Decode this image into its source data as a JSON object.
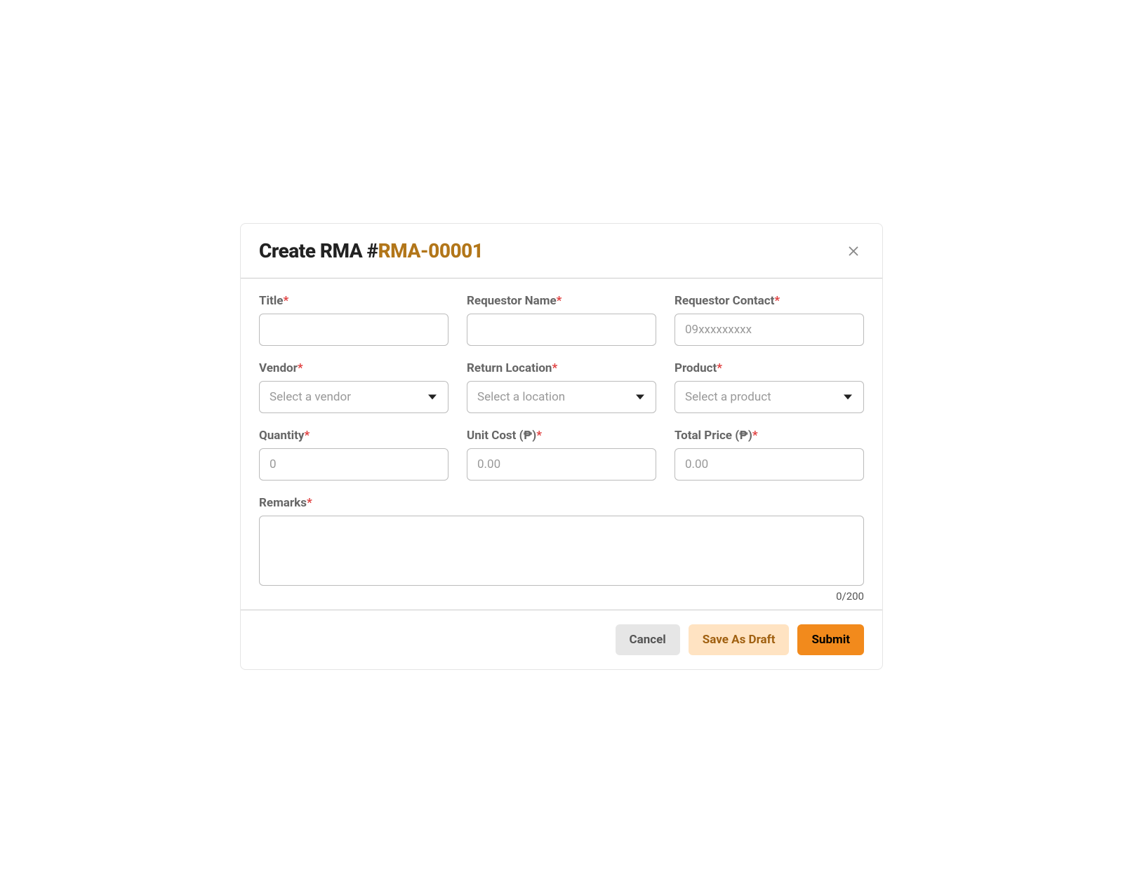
{
  "modal": {
    "title_prefix": "Create RMA #",
    "rma_number": "RMA-00001"
  },
  "fields": {
    "title": {
      "label": "Title",
      "value": "",
      "placeholder": ""
    },
    "requestor_name": {
      "label": "Requestor Name",
      "value": "",
      "placeholder": ""
    },
    "requestor_contact": {
      "label": "Requestor Contact",
      "value": "",
      "placeholder": "09xxxxxxxxx"
    },
    "vendor": {
      "label": "Vendor",
      "placeholder": "Select a vendor"
    },
    "return_location": {
      "label": "Return Location",
      "placeholder": "Select a location"
    },
    "product": {
      "label": "Product",
      "placeholder": "Select a product"
    },
    "quantity": {
      "label": "Quantity",
      "value": "",
      "placeholder": "0"
    },
    "unit_cost": {
      "label": "Unit Cost (₱)",
      "value": "",
      "placeholder": "0.00"
    },
    "total_price": {
      "label": "Total Price (₱)",
      "value": "",
      "placeholder": "0.00"
    },
    "remarks": {
      "label": "Remarks",
      "value": ""
    }
  },
  "char_counter": "0/200",
  "required_mark": "*",
  "buttons": {
    "cancel": "Cancel",
    "draft": "Save As Draft",
    "submit": "Submit"
  }
}
